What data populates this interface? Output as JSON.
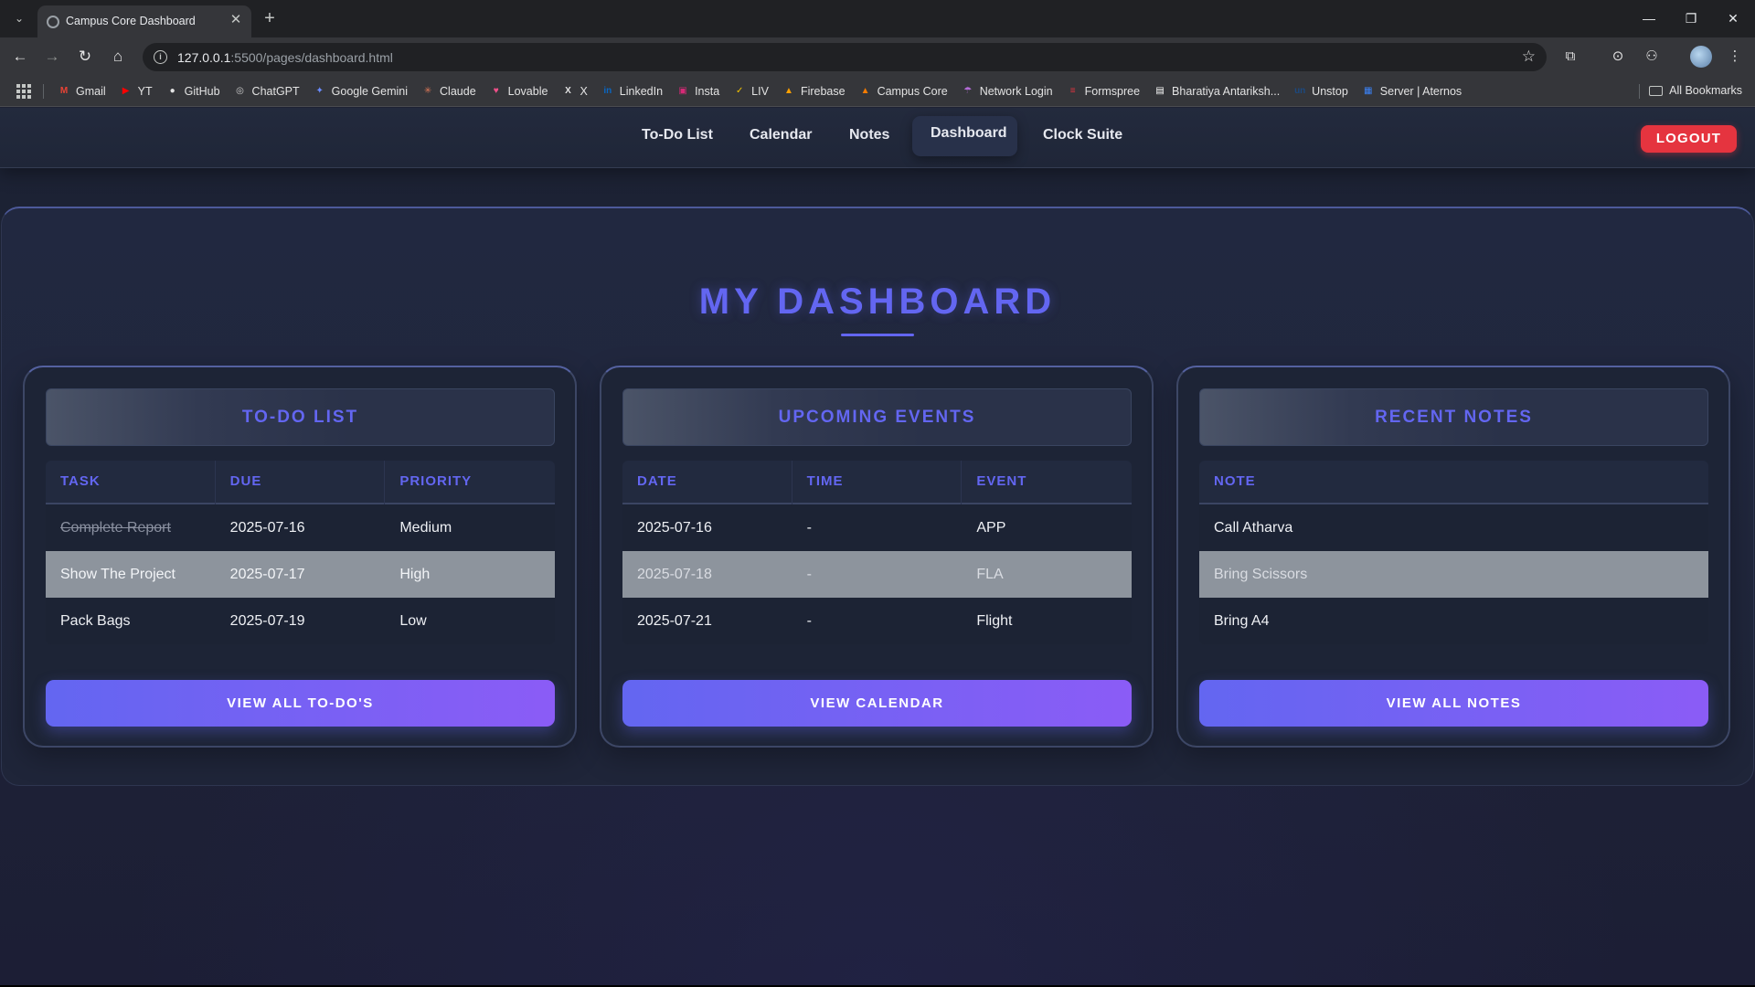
{
  "browser": {
    "tab_title": "Campus Core Dashboard",
    "url_host": "127.0.0.1",
    "url_rest": ":5500/pages/dashboard.html",
    "bookmarks": [
      {
        "label": "Gmail",
        "icon": "gmail-icon",
        "color": "#ea4335"
      },
      {
        "label": "YT",
        "icon": "youtube-icon",
        "color": "#ff0000"
      },
      {
        "label": "GitHub",
        "icon": "github-icon",
        "color": "#e3e3e3"
      },
      {
        "label": "ChatGPT",
        "icon": "chatgpt-icon",
        "color": "#cfcfcf"
      },
      {
        "label": "Google Gemini",
        "icon": "gemini-icon",
        "color": "#6b8cff"
      },
      {
        "label": "Claude",
        "icon": "claude-icon",
        "color": "#d97757"
      },
      {
        "label": "Lovable",
        "icon": "lovable-icon",
        "color": "#f0508a"
      },
      {
        "label": "X",
        "icon": "x-icon",
        "color": "#e3e3e3"
      },
      {
        "label": "LinkedIn",
        "icon": "linkedin-icon",
        "color": "#0a66c2"
      },
      {
        "label": "Insta",
        "icon": "instagram-icon",
        "color": "#d62976"
      },
      {
        "label": "LIV",
        "icon": "liv-icon",
        "color": "#f5c400"
      },
      {
        "label": "Firebase",
        "icon": "firebase-icon",
        "color": "#ffa000"
      },
      {
        "label": "Campus Core",
        "icon": "campus-core-icon",
        "color": "#f57c00"
      },
      {
        "label": "Network Login",
        "icon": "network-login-icon",
        "color": "#b36bd6"
      },
      {
        "label": "Formspree",
        "icon": "formspree-icon",
        "color": "#e5343f"
      },
      {
        "label": "Bharatiya Antariksh...",
        "icon": "bharatiya-antariksh-icon",
        "color": "#ffffff"
      },
      {
        "label": "Unstop",
        "icon": "unstop-icon",
        "color": "#1c4980"
      },
      {
        "label": "Server | Aternos",
        "icon": "aternos-icon",
        "color": "#3b82f6"
      }
    ],
    "all_bookmarks": "All Bookmarks"
  },
  "nav": {
    "links": [
      "To-Do List",
      "Calendar",
      "Notes",
      "Dashboard",
      "Clock Suite"
    ],
    "active": "Dashboard",
    "logout": "LOGOUT"
  },
  "page_title": "MY DASHBOARD",
  "cards": {
    "todo": {
      "title": "TO-DO LIST",
      "columns": [
        "TASK",
        "DUE",
        "PRIORITY"
      ],
      "rows": [
        [
          "Complete Report",
          "2025-07-16",
          "Medium"
        ],
        [
          "Show The Project",
          "2025-07-17",
          "High"
        ],
        [
          "Pack Bags",
          "2025-07-19",
          "Low"
        ]
      ],
      "button": "VIEW ALL TO-DO'S"
    },
    "events": {
      "title": "UPCOMING EVENTS",
      "columns": [
        "DATE",
        "TIME",
        "EVENT"
      ],
      "rows": [
        [
          "2025-07-16",
          "-",
          "APP"
        ],
        [
          "2025-07-18",
          "-",
          "FLA"
        ],
        [
          "2025-07-21",
          "-",
          "Flight"
        ]
      ],
      "button": "VIEW CALENDAR"
    },
    "notes": {
      "title": "RECENT NOTES",
      "columns": [
        "NOTE"
      ],
      "rows": [
        [
          "Call Atharva"
        ],
        [
          "Bring Scissors"
        ],
        [
          "Bring A4"
        ]
      ],
      "button": "VIEW ALL NOTES"
    }
  },
  "colors": {
    "accent": "#6366f1",
    "accent2": "#8b5cf6",
    "logout": "#e5343f",
    "highlight_row": "#8d949d"
  }
}
